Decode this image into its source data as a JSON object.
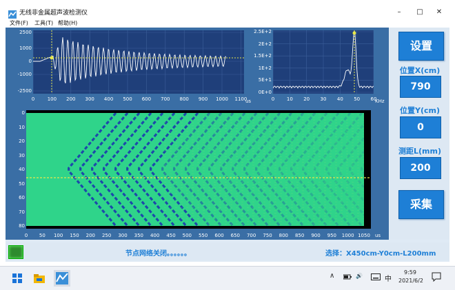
{
  "window": {
    "title": "无线非金属超声波检测仪",
    "minimize_glyph": "–",
    "maximize_glyph": "□",
    "close_glyph": "✕"
  },
  "menu": [
    {
      "label": "文件(F)"
    },
    {
      "label": "工具(T)"
    },
    {
      "label": "帮助(H)"
    }
  ],
  "waveform": {
    "y_ticks": [
      "2500",
      "1000",
      "0",
      "-1000",
      "-2500"
    ],
    "x_ticks": [
      "0",
      "100",
      "200",
      "300",
      "400",
      "500",
      "600",
      "700",
      "800",
      "900",
      "1000",
      "1100"
    ],
    "x_unit": "us"
  },
  "spectrum": {
    "y_ticks": [
      "2.5E+2",
      "2E+2",
      "1.5E+2",
      "1E+2",
      "5E+1",
      "0E+0"
    ],
    "x_ticks": [
      "0",
      "10",
      "20",
      "30",
      "40",
      "50",
      "60"
    ],
    "x_unit": "KHz"
  },
  "scan": {
    "y_ticks": [
      "0",
      "10",
      "20",
      "30",
      "40",
      "50",
      "60",
      "70",
      "80"
    ],
    "x_ticks": [
      "0",
      "50",
      "100",
      "150",
      "200",
      "250",
      "300",
      "350",
      "400",
      "450",
      "500",
      "550",
      "600",
      "650",
      "700",
      "750",
      "800",
      "850",
      "900",
      "950",
      "1000",
      "1050"
    ],
    "x_unit": "us"
  },
  "side": {
    "settings_button": "设置",
    "pos_x_label": "位置X(cm)",
    "pos_x_value": "790",
    "pos_y_label": "位置Y(cm)",
    "pos_y_value": "0",
    "distance_label": "测距L(mm)",
    "distance_value": "200",
    "acquire_button": "采集"
  },
  "status": {
    "message": "节点网络关闭。。。。。。",
    "selection": "选择：X450cm-Y0cm-L200mm"
  },
  "taskbar": {
    "tray_chevron": "∧",
    "tray_volume": "🔊",
    "ime": "中",
    "time": "9:59",
    "date": "2021/6/2"
  },
  "colors": {
    "plot_bg": "#1f3f7a",
    "trace": "#ffffff",
    "marker": "#e8e84a",
    "scan_green": "#2fd48a",
    "scan_blue": "#1a2fb0",
    "accent": "#1e7fd6"
  }
}
